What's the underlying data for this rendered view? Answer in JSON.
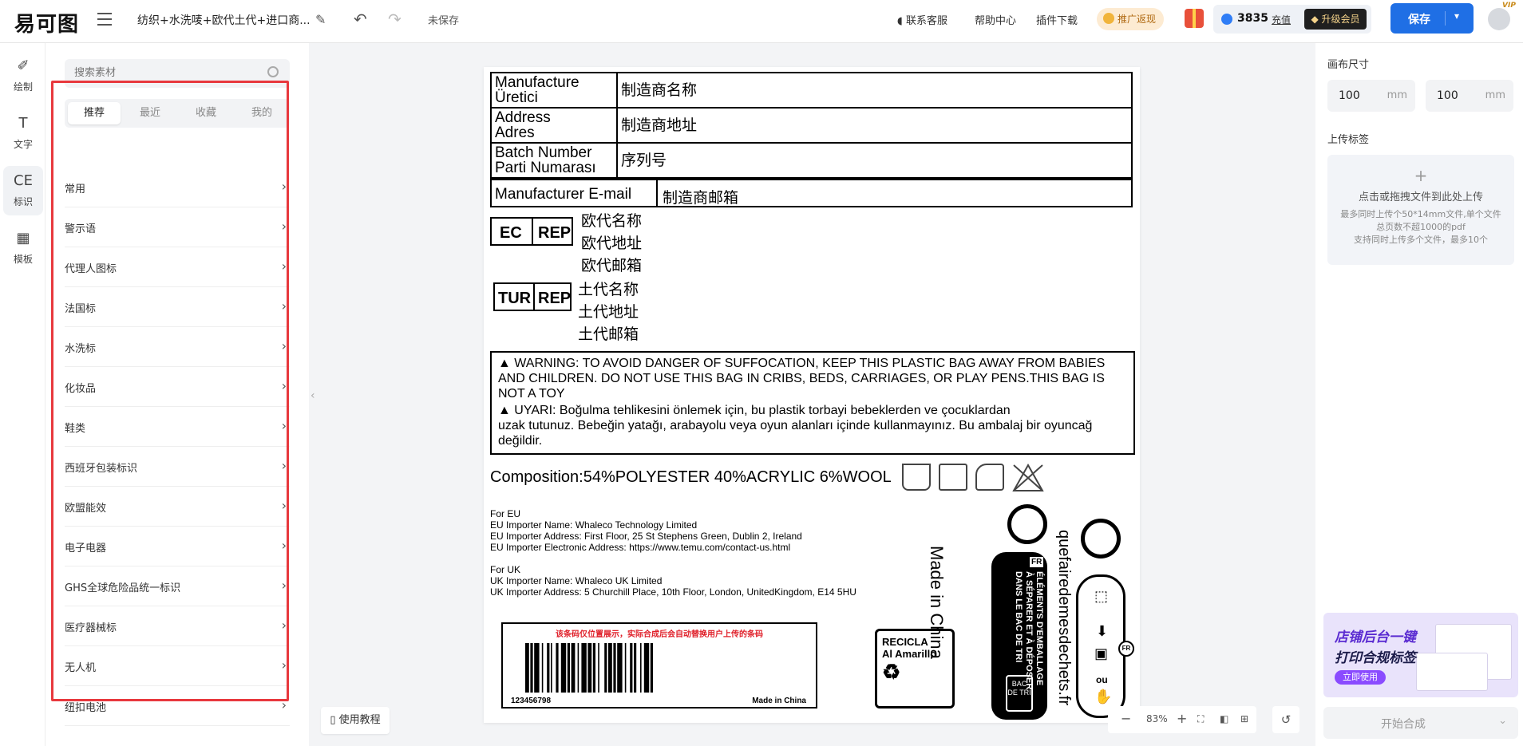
{
  "header": {
    "logo": "易可图",
    "doc_title": "纺织+水洗唛+欧代土代+进口商...",
    "save_state": "未保存",
    "links": [
      "联系客服",
      "帮助中心",
      "插件下载"
    ],
    "promo": "推广返现",
    "points": "3835",
    "recharge": "充值",
    "vip_upgrade": "升级会员",
    "save_label": "保存",
    "vip_badge": "VIP",
    "accent_color": "#1f6fe5"
  },
  "rail": {
    "items": [
      {
        "label": "绘制",
        "icon": "pencil-icon"
      },
      {
        "label": "文字",
        "icon": "text-icon"
      },
      {
        "label": "标识",
        "icon": "ce-mark-icon"
      },
      {
        "label": "模板",
        "icon": "grid-icon"
      }
    ]
  },
  "panel": {
    "search_placeholder": "搜索素材",
    "tabs": [
      "推荐",
      "最近",
      "收藏",
      "我的"
    ],
    "categories": [
      "常用",
      "警示语",
      "代理人图标",
      "法国标",
      "水洗标",
      "化妆品",
      "鞋类",
      "西班牙包装标识",
      "欧盟能效",
      "电子电器",
      "GHS全球危险品统一标识",
      "医疗器械标",
      "无人机",
      "纽扣电池"
    ],
    "tutorial": "使用教程"
  },
  "label": {
    "rows": [
      {
        "key": "Manufacture\nÜretici",
        "value": "制造商名称"
      },
      {
        "key": "Address\nAdres",
        "value": "制造商地址"
      },
      {
        "key": "Batch Number\nParti Numarası",
        "value": "序列号"
      }
    ],
    "email_key": "Manufacturer E-mail",
    "email_value": "制造商邮箱",
    "ec": "EC",
    "rep": "REP",
    "tur": "TUR",
    "ec_lines": [
      "欧代名称",
      "欧代地址",
      "欧代邮箱"
    ],
    "tur_lines": [
      "土代名称",
      "土代地址",
      "土代邮箱"
    ],
    "warning_en": "WARNING: TO AVOID DANGER OF SUFFOCATION, KEEP THIS PLASTIC BAG AWAY FROM BABIES AND CHILDREN. DO NOT USE THIS BAG IN CRIBS, BEDS, CARRIAGES, OR PLAY PENS.THIS BAG IS NOT A TOY",
    "warning_tr_1": "UYARI: Boğulma tehlikesini önlemek için, bu plastik torbayi bebeklerden ve çocuklardan",
    "warning_tr_2": "uzak tutunuz. Bebeğin yatağı, arabayolu veya oyun alanları içinde kullanmayınız. Bu ambalaj bir oyuncağ değildir.",
    "composition": "Composition:54%POLYESTER 40%ACRYLIC 6%WOOL",
    "importer_lines": [
      "For EU",
      "EU Importer Name: Whaleco Technology Limited",
      "EU Importer Address: First Floor, 25 St Stephens Green, Dublin 2, Ireland",
      "EU Importer Electronic Address: https://www.temu.com/contact-us.html",
      "",
      "For UK",
      "UK Importer Name: Whaleco UK Limited",
      "UK Importer Address: 5 Churchill Place, 10th Floor, London, UnitedKingdom, E14 5HU"
    ],
    "barcode_note": "该条码仅位置展示，实际合成后会自动替换用户上传的条码",
    "barcode_number": "123456798",
    "barcode_made_in": "Made in China",
    "recicla_1": "RECICLA",
    "recicla_2": "Al Amarillo",
    "made_in": "Made in China",
    "fr_badge": "FR",
    "fr_text_1": "ÉLÉMENTS D'EMBALLAGE",
    "fr_text_2": "À SÉPARER ET À DÉPOSER",
    "fr_text_3": "DANS LE BAC DE TRI",
    "fr_bac": "BAC DE TRI",
    "site": "quefairedemesdechets.fr",
    "ou": "ou"
  },
  "zoom": {
    "minus": "−",
    "value": "83%",
    "plus": "+"
  },
  "right": {
    "canvas_size": "画布尺寸",
    "width": "100",
    "height": "100",
    "unit": "mm",
    "upload_label": "上传标签",
    "upload_main": "点击或拖拽文件到此处上传",
    "upload_hint_1": "最多同时上传个50*14mm文件,单个文件",
    "upload_hint_2": "总页数不超1000的pdf",
    "upload_hint_3": "支持同时上传多个文件，最多10个",
    "banner_1": "店铺后台一键",
    "banner_2": "打印合规标签",
    "banner_cta": "立即使用",
    "synth": "开始合成"
  }
}
